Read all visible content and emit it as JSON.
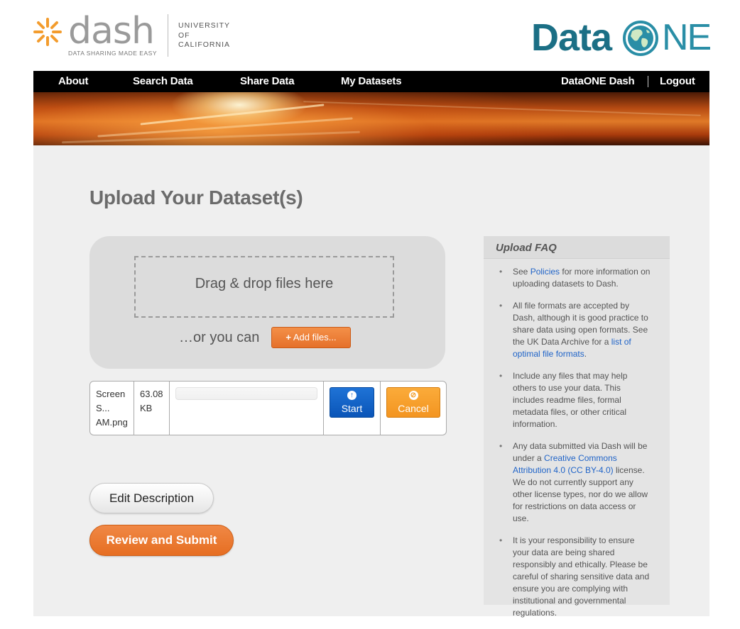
{
  "header": {
    "dash_word": "dash",
    "dash_tagline": "DATA SHARING MADE EASY",
    "uc_line1": "UNIVERSITY",
    "uc_line2": "OF",
    "uc_line3": "CALIFORNIA",
    "dataone_data": "Data",
    "dataone_ne": "NE"
  },
  "nav": {
    "about": "About",
    "search": "Search Data",
    "share": "Share Data",
    "my_datasets": "My Datasets",
    "dataone_dash": "DataONE Dash",
    "logout": "Logout"
  },
  "main": {
    "title": "Upload Your Dataset(s)",
    "dropzone_text": "Drag & drop files here",
    "or_text": "…or you can",
    "add_files_label": "Add files...",
    "file": {
      "name_line1": "Screen",
      "name_line2": "S...",
      "name_line3": "AM.png",
      "size_line1": "63.08",
      "size_line2": "KB",
      "progress": 0,
      "start_label": "Start",
      "cancel_label": "Cancel"
    },
    "edit_description_label": "Edit Description",
    "review_submit_label": "Review and Submit"
  },
  "faq": {
    "title": "Upload FAQ",
    "item1_pre": "See ",
    "item1_link": "Policies",
    "item1_post": " for more information on uploading datasets to Dash.",
    "item2_pre": "All file formats are accepted by Dash, although it is good practice to share data using open formats. See the UK Data Archive for a ",
    "item2_link": "list of optimal file formats",
    "item2_post": ".",
    "item3": "Include any files that may help others to use your data. This includes readme files, formal metadata files, or other critical information.",
    "item4_pre": "Any data submitted via Dash will be under a ",
    "item4_link": "Creative Commons Attribution 4.0 (CC BY-4.0)",
    "item4_post": " license. We do not currently support any other license types, nor do we allow for restrictions on data access or use.",
    "item5": "It is your responsibility to ensure your data are being shared responsibly and ethically. Please be careful of sharing sensitive data and ensure you are complying with institutional and governmental regulations."
  },
  "colors": {
    "dash_orange": "#f39c2d",
    "dataone_teal": "#1b6f85",
    "link_blue": "#2064c8",
    "orange_button": "#e66e22",
    "start_blue": "#0a55b8"
  },
  "icons": {
    "dash_logo": "sunburst-icon",
    "dataone_globe": "globe-icon",
    "add": "plus-icon",
    "start": "upload-arrow-icon",
    "cancel": "ban-icon"
  }
}
